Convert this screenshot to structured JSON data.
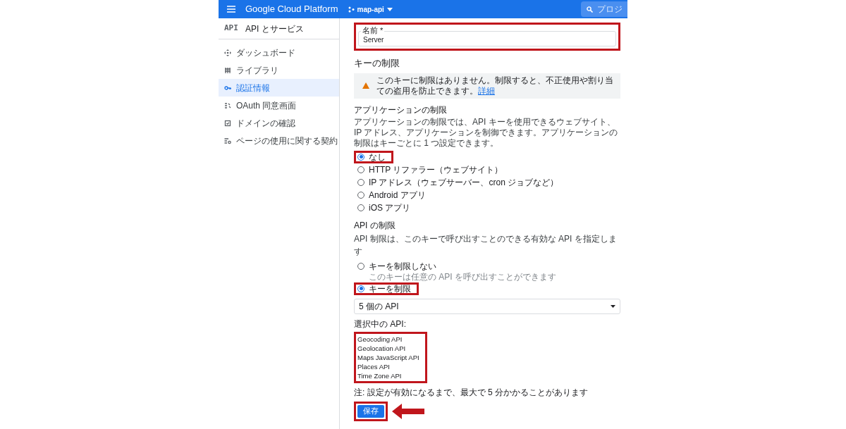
{
  "topbar": {
    "app_title": "Google Cloud Platform",
    "project": "map-api",
    "search_placeholder": "プロジ"
  },
  "sidebar": {
    "title_badge": "API",
    "title": "API とサービス",
    "items": [
      {
        "label": "ダッシュボード",
        "selected": false
      },
      {
        "label": "ライブラリ",
        "selected": false
      },
      {
        "label": "認証情報",
        "selected": true
      },
      {
        "label": "OAuth 同意画面",
        "selected": false
      },
      {
        "label": "ドメインの確認",
        "selected": false
      },
      {
        "label": "ページの使用に関する契約",
        "selected": false
      }
    ]
  },
  "name_field": {
    "label": "名前 *",
    "value": "Server",
    "highlighted": true
  },
  "key_restriction": {
    "heading": "キーの制限",
    "warning": "このキーに制限はありません。制限すると、不正使用や割り当ての盗用を防止できます。",
    "link": "詳細"
  },
  "app_restriction": {
    "heading": "アプリケーションの制限",
    "description": "アプリケーションの制限では、API キーを使用できるウェブサイト、IP アドレス、アプリケーションを制御できます。アプリケーションの制限はキーごとに 1 つ設定できます。",
    "options": [
      {
        "label": "なし",
        "selected": true,
        "highlighted": true
      },
      {
        "label": "HTTP リファラー（ウェブサイト）",
        "selected": false,
        "highlighted": false
      },
      {
        "label": "IP アドレス（ウェブサーバー、cron ジョブなど）",
        "selected": false,
        "highlighted": false
      },
      {
        "label": "Android アプリ",
        "selected": false,
        "highlighted": false
      },
      {
        "label": "iOS アプリ",
        "selected": false,
        "highlighted": false
      }
    ]
  },
  "api_restriction": {
    "heading": "API の制限",
    "description": "API 制限は、このキーで呼び出すことのできる有効な API を指定します",
    "options": [
      {
        "label": "キーを制限しない",
        "hint": "このキーは任意の API を呼び出すことができます",
        "selected": false,
        "highlighted": false
      },
      {
        "label": "キーを制限",
        "selected": true,
        "highlighted": true
      }
    ],
    "dropdown_value": "5 個の API",
    "selected_heading": "選択中の API:",
    "selected_highlighted": true,
    "selected_apis": [
      "Geocoding API",
      "Geolocation API",
      "Maps JavaScript API",
      "Places API",
      "Time Zone API"
    ]
  },
  "note": "注: 設定が有効になるまで、最大で 5 分かかることがあります",
  "save_button": {
    "label": "保存",
    "highlighted": true
  }
}
